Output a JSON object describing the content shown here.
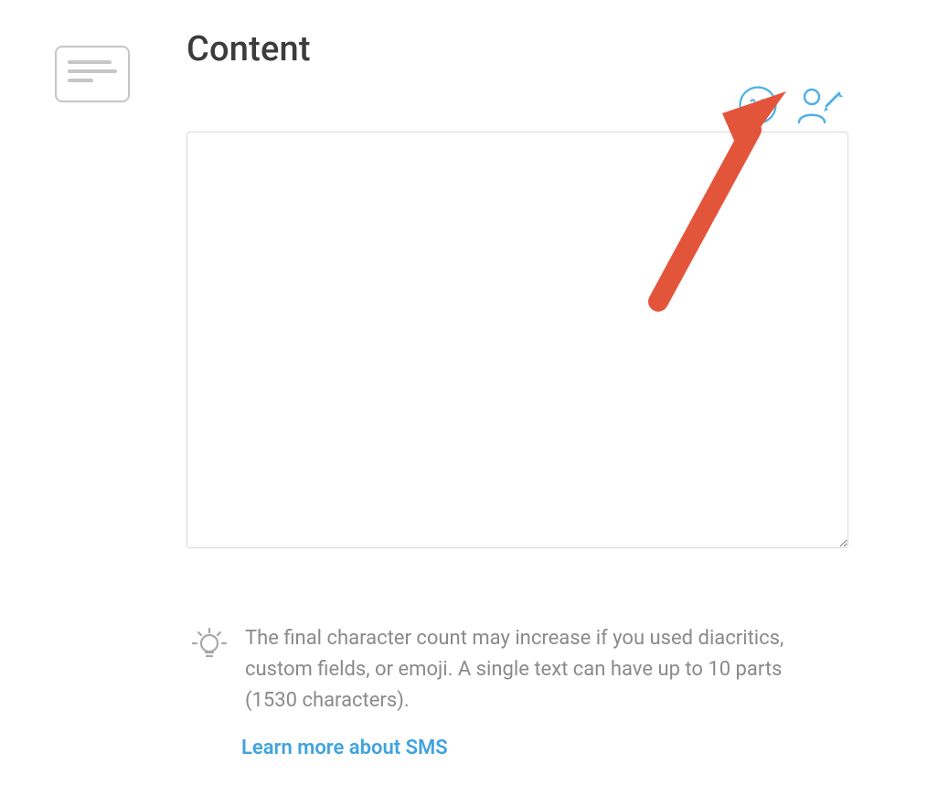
{
  "section": {
    "title": "Content"
  },
  "editor": {
    "value": "",
    "placeholder": ""
  },
  "hint": {
    "text": "The final character count may increase if you used diacritics, custom fields, or emoji. A single text can have up to 10 parts (1530 characters).",
    "link_label": "Learn more about SMS"
  }
}
